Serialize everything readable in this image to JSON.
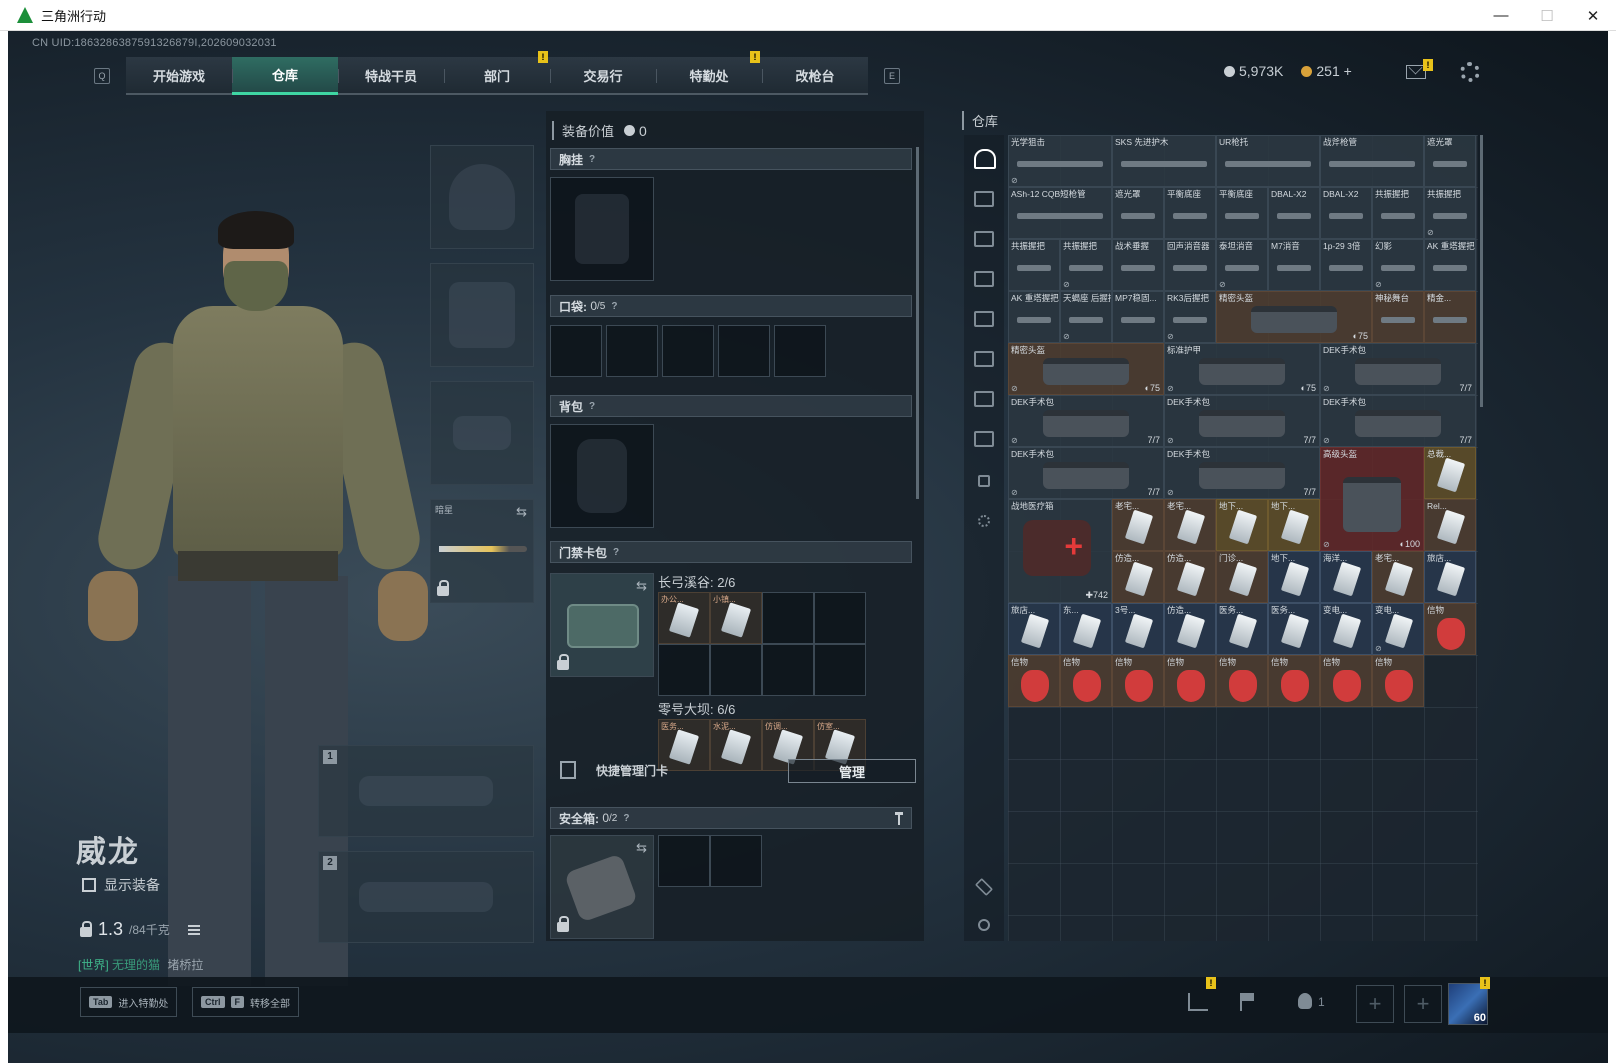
{
  "window": {
    "title": "三角洲行动",
    "minimize": "—",
    "maximize": "☐",
    "close": "✕"
  },
  "uid": "CN UID:1863286387591326879I,202609032031",
  "nav": {
    "key_left": "Q",
    "key_right": "E",
    "tabs": [
      {
        "label": "开始游戏",
        "badge": ""
      },
      {
        "label": "仓库",
        "badge": "",
        "active": true
      },
      {
        "label": "特战干员",
        "badge": ""
      },
      {
        "label": "部门",
        "badge": "!"
      },
      {
        "label": "交易行",
        "badge": ""
      },
      {
        "label": "特勤处",
        "badge": "!"
      },
      {
        "label": "改枪台",
        "badge": ""
      }
    ]
  },
  "currency": {
    "silver": "5,973K",
    "gold": "251",
    "plus": "+",
    "silver_color": "#c9cfd4",
    "gold_color": "#d9a23a",
    "mail_badge": "!"
  },
  "character": {
    "name": "威龙",
    "show_equip_label": "显示装备",
    "weight_value": "1.3",
    "weight_unit": "/84千克",
    "chat_channel": "[世界]",
    "chat_user": "无理的猫",
    "chat_msg": "堵桥拉"
  },
  "gear_slots": {
    "melee_label": "暗星",
    "primary_num": "1",
    "secondary_num": "2"
  },
  "equipment": {
    "value_label": "装备价值",
    "value": "0",
    "chest_label": "胸挂",
    "pocket_label": "口袋:",
    "pocket_count": "0",
    "pocket_max": "/5",
    "backpack_label": "背包",
    "keycard_label": "门禁卡包",
    "card_group1_title": "长弓溪谷: 2/6",
    "card_group1": [
      {
        "label": "办公..."
      },
      {
        "label": "小镇..."
      }
    ],
    "card_group2_title": "零号大坝: 6/6",
    "card_group2": [
      {
        "label": "医务..."
      },
      {
        "label": "水泥..."
      },
      {
        "label": "仿调..."
      },
      {
        "label": "仿室..."
      }
    ],
    "quick_manage_label": "快捷管理门卡",
    "manage_button": "管理",
    "safebox_label": "安全箱:",
    "safebox_count": "0",
    "safebox_max": "/2",
    "q": "?"
  },
  "warehouse": {
    "title": "仓库",
    "items": [
      {
        "name": "光学狙击",
        "c": 0,
        "r": 0,
        "w": 2,
        "h": 1,
        "t": "rifle",
        "k": "",
        "corner": "⊘"
      },
      {
        "name": "SKS 先进护木",
        "c": 2,
        "r": 0,
        "w": 2,
        "h": 1,
        "t": "rifle",
        "k": ""
      },
      {
        "name": "UR枪托",
        "c": 4,
        "r": 0,
        "w": 2,
        "h": 1,
        "t": "rifle",
        "k": ""
      },
      {
        "name": "战斧枪管",
        "c": 6,
        "r": 0,
        "w": 2,
        "h": 1,
        "t": "rifle",
        "k": ""
      },
      {
        "name": "遮光罩",
        "c": 8,
        "r": 0,
        "w": 1,
        "h": 1,
        "t": "part",
        "k": ""
      },
      {
        "name": "ASh-12 CQB短枪管",
        "c": 0,
        "r": 1,
        "w": 2,
        "h": 1,
        "t": "rifle",
        "k": ""
      },
      {
        "name": "遮光罩",
        "c": 2,
        "r": 1,
        "w": 1,
        "h": 1,
        "t": "part",
        "k": ""
      },
      {
        "name": "平衡底座",
        "c": 3,
        "r": 1,
        "w": 1,
        "h": 1,
        "t": "part",
        "k": ""
      },
      {
        "name": "平衡底座",
        "c": 4,
        "r": 1,
        "w": 1,
        "h": 1,
        "t": "part",
        "k": ""
      },
      {
        "name": "DBAL-X2",
        "c": 5,
        "r": 1,
        "w": 1,
        "h": 1,
        "t": "part",
        "k": ""
      },
      {
        "name": "DBAL-X2",
        "c": 6,
        "r": 1,
        "w": 1,
        "h": 1,
        "t": "part",
        "k": ""
      },
      {
        "name": "共振握把",
        "c": 7,
        "r": 1,
        "w": 1,
        "h": 1,
        "t": "part",
        "k": ""
      },
      {
        "name": "共振握把",
        "c": 8,
        "r": 1,
        "w": 1,
        "h": 1,
        "t": "part",
        "k": "",
        "corner": "⊘"
      },
      {
        "name": "共振握把",
        "c": 0,
        "r": 2,
        "w": 1,
        "h": 1,
        "t": "part",
        "k": ""
      },
      {
        "name": "共振握把",
        "c": 1,
        "r": 2,
        "w": 1,
        "h": 1,
        "t": "part",
        "k": "",
        "corner": "⊘"
      },
      {
        "name": "战术垂握",
        "c": 2,
        "r": 2,
        "w": 1,
        "h": 1,
        "t": "part",
        "k": ""
      },
      {
        "name": "回声消音器",
        "c": 3,
        "r": 2,
        "w": 1,
        "h": 1,
        "t": "part",
        "k": ""
      },
      {
        "name": "泰坦消音",
        "c": 4,
        "r": 2,
        "w": 1,
        "h": 1,
        "t": "part",
        "k": "",
        "corner": "⊘"
      },
      {
        "name": "M7消音",
        "c": 5,
        "r": 2,
        "w": 1,
        "h": 1,
        "t": "part",
        "k": ""
      },
      {
        "name": "1p-29 3倍",
        "c": 6,
        "r": 2,
        "w": 1,
        "h": 1,
        "t": "part",
        "k": ""
      },
      {
        "name": "幻影",
        "c": 7,
        "r": 2,
        "w": 1,
        "h": 1,
        "t": "part",
        "k": "",
        "corner": "⊘"
      },
      {
        "name": "AK 重塔握把",
        "c": 8,
        "r": 2,
        "w": 1,
        "h": 1,
        "t": "part",
        "k": ""
      },
      {
        "name": "AK 重塔握把",
        "c": 0,
        "r": 3,
        "w": 1,
        "h": 1,
        "t": "part",
        "k": ""
      },
      {
        "name": "天蝎座 后握把",
        "c": 1,
        "r": 3,
        "w": 1,
        "h": 1,
        "t": "part",
        "k": "",
        "corner": "⊘"
      },
      {
        "name": "MP7稳固...",
        "c": 2,
        "r": 3,
        "w": 1,
        "h": 1,
        "t": "part",
        "k": ""
      },
      {
        "name": "RK3后握把",
        "c": 3,
        "r": 3,
        "w": 1,
        "h": 1,
        "t": "part",
        "k": "",
        "corner": "⊘"
      },
      {
        "name": "精密头盔",
        "c": 4,
        "r": 3,
        "w": 3,
        "h": 1,
        "t": "bag",
        "k": "brown",
        "badge": "◐75"
      },
      {
        "name": "神秘舞台",
        "c": 7,
        "r": 3,
        "w": 1,
        "h": 1,
        "t": "part",
        "k": "brown"
      },
      {
        "name": "精金...",
        "c": 8,
        "r": 3,
        "w": 1,
        "h": 1,
        "t": "part",
        "k": "brown"
      },
      {
        "name": "精密头盔",
        "c": 0,
        "r": 4,
        "w": 3,
        "h": 1,
        "t": "bag",
        "k": "brown",
        "badge": "◐75",
        "corner": "⊘"
      },
      {
        "name": "标准护甲",
        "c": 3,
        "r": 4,
        "w": 3,
        "h": 1,
        "t": "bag",
        "k": "",
        "badge": "◐75",
        "corner": "⊘"
      },
      {
        "name": "DEK手术包",
        "c": 6,
        "r": 4,
        "w": 3,
        "h": 1,
        "t": "bag",
        "k": "",
        "badge": "7/7",
        "corner": "⊘"
      },
      {
        "name": "DEK手术包",
        "c": 0,
        "r": 5,
        "w": 3,
        "h": 1,
        "t": "bag",
        "k": "",
        "badge": "7/7",
        "corner": "⊘"
      },
      {
        "name": "DEK手术包",
        "c": 3,
        "r": 5,
        "w": 3,
        "h": 1,
        "t": "bag",
        "k": "",
        "badge": "7/7",
        "corner": "⊘"
      },
      {
        "name": "DEK手术包",
        "c": 6,
        "r": 5,
        "w": 3,
        "h": 1,
        "t": "bag",
        "k": "",
        "badge": "7/7",
        "corner": "⊘"
      },
      {
        "name": "DEK手术包",
        "c": 0,
        "r": 6,
        "w": 3,
        "h": 1,
        "t": "bag",
        "k": "",
        "badge": "7/7",
        "corner": "⊘"
      },
      {
        "name": "DEK手术包",
        "c": 3,
        "r": 6,
        "w": 3,
        "h": 1,
        "t": "bag",
        "k": "",
        "badge": "7/7",
        "corner": "⊘"
      },
      {
        "name": "高级头盔",
        "c": 6,
        "r": 6,
        "w": 2,
        "h": 2,
        "t": "bag",
        "k": "red",
        "badge": "◐100",
        "corner": "⊘"
      },
      {
        "name": "总裁...",
        "c": 8,
        "r": 6,
        "w": 1,
        "h": 1,
        "t": "card",
        "k": "gold"
      },
      {
        "name": "战地医疗箱",
        "c": 0,
        "r": 7,
        "w": 2,
        "h": 2,
        "t": "med",
        "k": "",
        "badge": "✚742"
      },
      {
        "name": "老宅...",
        "c": 2,
        "r": 7,
        "w": 1,
        "h": 1,
        "t": "card",
        "k": "brown"
      },
      {
        "name": "老宅...",
        "c": 3,
        "r": 7,
        "w": 1,
        "h": 1,
        "t": "card",
        "k": "brown"
      },
      {
        "name": "地下...",
        "c": 4,
        "r": 7,
        "w": 1,
        "h": 1,
        "t": "card",
        "k": "gold"
      },
      {
        "name": "地下...",
        "c": 5,
        "r": 7,
        "w": 1,
        "h": 1,
        "t": "card",
        "k": "gold"
      },
      {
        "name": "Rel...",
        "c": 8,
        "r": 7,
        "w": 1,
        "h": 1,
        "t": "card",
        "k": "brown"
      },
      {
        "name": "仿造...",
        "c": 2,
        "r": 8,
        "w": 1,
        "h": 1,
        "t": "card",
        "k": "brown"
      },
      {
        "name": "仿造...",
        "c": 3,
        "r": 8,
        "w": 1,
        "h": 1,
        "t": "card",
        "k": "brown"
      },
      {
        "name": "门诊...",
        "c": 4,
        "r": 8,
        "w": 1,
        "h": 1,
        "t": "card",
        "k": "brown"
      },
      {
        "name": "地下...",
        "c": 5,
        "r": 8,
        "w": 1,
        "h": 1,
        "t": "card",
        "k": "blue"
      },
      {
        "name": "海洋...",
        "c": 6,
        "r": 8,
        "w": 1,
        "h": 1,
        "t": "card",
        "k": "blue"
      },
      {
        "name": "老宅...",
        "c": 7,
        "r": 8,
        "w": 1,
        "h": 1,
        "t": "card",
        "k": "brown"
      },
      {
        "name": "旅店...",
        "c": 8,
        "r": 8,
        "w": 1,
        "h": 1,
        "t": "card",
        "k": "blue"
      },
      {
        "name": "旅店...",
        "c": 0,
        "r": 9,
        "w": 1,
        "h": 1,
        "t": "card",
        "k": "blue"
      },
      {
        "name": "东...",
        "c": 1,
        "r": 9,
        "w": 1,
        "h": 1,
        "t": "card",
        "k": "blue"
      },
      {
        "name": "3号...",
        "c": 2,
        "r": 9,
        "w": 1,
        "h": 1,
        "t": "card",
        "k": "blue"
      },
      {
        "name": "仿造...",
        "c": 3,
        "r": 9,
        "w": 1,
        "h": 1,
        "t": "card",
        "k": "blue"
      },
      {
        "name": "医务...",
        "c": 4,
        "r": 9,
        "w": 1,
        "h": 1,
        "t": "card",
        "k": "blue"
      },
      {
        "name": "医务...",
        "c": 5,
        "r": 9,
        "w": 1,
        "h": 1,
        "t": "card",
        "k": "blue"
      },
      {
        "name": "变电...",
        "c": 6,
        "r": 9,
        "w": 1,
        "h": 1,
        "t": "card",
        "k": "blue"
      },
      {
        "name": "变电...",
        "c": 7,
        "r": 9,
        "w": 1,
        "h": 1,
        "t": "card",
        "k": "blue",
        "corner": "⊘"
      },
      {
        "name": "信物",
        "c": 8,
        "r": 9,
        "w": 1,
        "h": 1,
        "t": "mask",
        "k": "brown"
      },
      {
        "name": "信物",
        "c": 0,
        "r": 10,
        "w": 1,
        "h": 1,
        "t": "mask",
        "k": "brown"
      },
      {
        "name": "信物",
        "c": 1,
        "r": 10,
        "w": 1,
        "h": 1,
        "t": "mask",
        "k": "brown"
      },
      {
        "name": "信物",
        "c": 2,
        "r": 10,
        "w": 1,
        "h": 1,
        "t": "mask",
        "k": "brown"
      },
      {
        "name": "信物",
        "c": 3,
        "r": 10,
        "w": 1,
        "h": 1,
        "t": "mask",
        "k": "brown"
      },
      {
        "name": "信物",
        "c": 4,
        "r": 10,
        "w": 1,
        "h": 1,
        "t": "mask",
        "k": "brown"
      },
      {
        "name": "信物",
        "c": 5,
        "r": 10,
        "w": 1,
        "h": 1,
        "t": "mask",
        "k": "brown"
      },
      {
        "name": "信物",
        "c": 6,
        "r": 10,
        "w": 1,
        "h": 1,
        "t": "mask",
        "k": "brown"
      },
      {
        "name": "信物",
        "c": 7,
        "r": 10,
        "w": 1,
        "h": 1,
        "t": "mask",
        "k": "brown"
      }
    ]
  },
  "bottombar": {
    "tab_key": "Tab",
    "tab_label": "进入特勤处",
    "ctrl_key": "Ctrl",
    "f_key": "F",
    "transfer_label": "转移全部",
    "squad_count": "1",
    "plus": "+",
    "level": "60",
    "stats_badge": "!",
    "avatar_badge": "!"
  }
}
